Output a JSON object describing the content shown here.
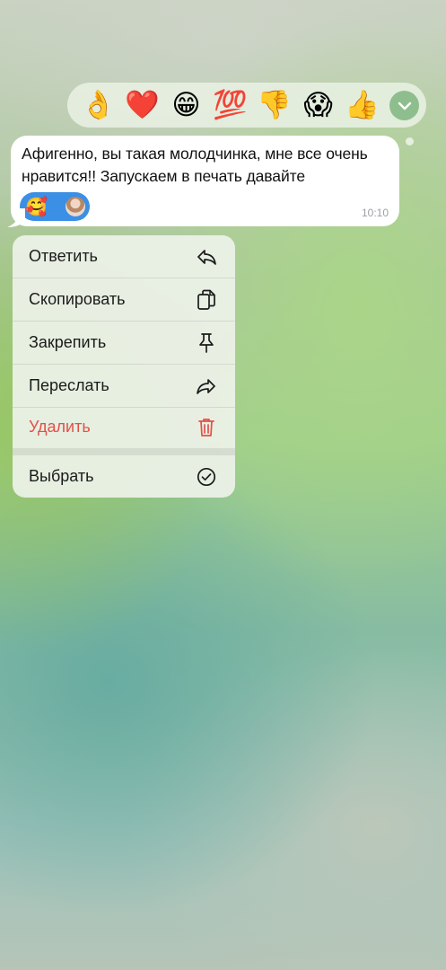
{
  "reactions": [
    {
      "icon": "ok-hand-emoji",
      "glyph": "👌"
    },
    {
      "icon": "red-heart-emoji",
      "glyph": "❤️"
    },
    {
      "icon": "grinning-face-emoji",
      "glyph": "😁"
    },
    {
      "icon": "hundred-points-emoji",
      "glyph": "💯"
    },
    {
      "icon": "thumbs-down-emoji",
      "glyph": "👎"
    },
    {
      "icon": "screaming-face-emoji",
      "glyph": "😱"
    },
    {
      "icon": "thumbs-up-emoji",
      "glyph": "👍"
    }
  ],
  "message": {
    "text": "Афигенно, вы такая молодчинка, мне все очень нравится!! Запускаем в печать давайте",
    "reaction_emoji": "🥰",
    "time": "10:10"
  },
  "menu": {
    "reply": "Ответить",
    "copy": "Скопировать",
    "pin": "Закрепить",
    "forward": "Переслать",
    "delete": "Удалить",
    "select": "Выбрать"
  },
  "colors": {
    "accent": "#3b8fe4",
    "danger": "#e2504a",
    "expand_button": "#8fbe8e"
  }
}
